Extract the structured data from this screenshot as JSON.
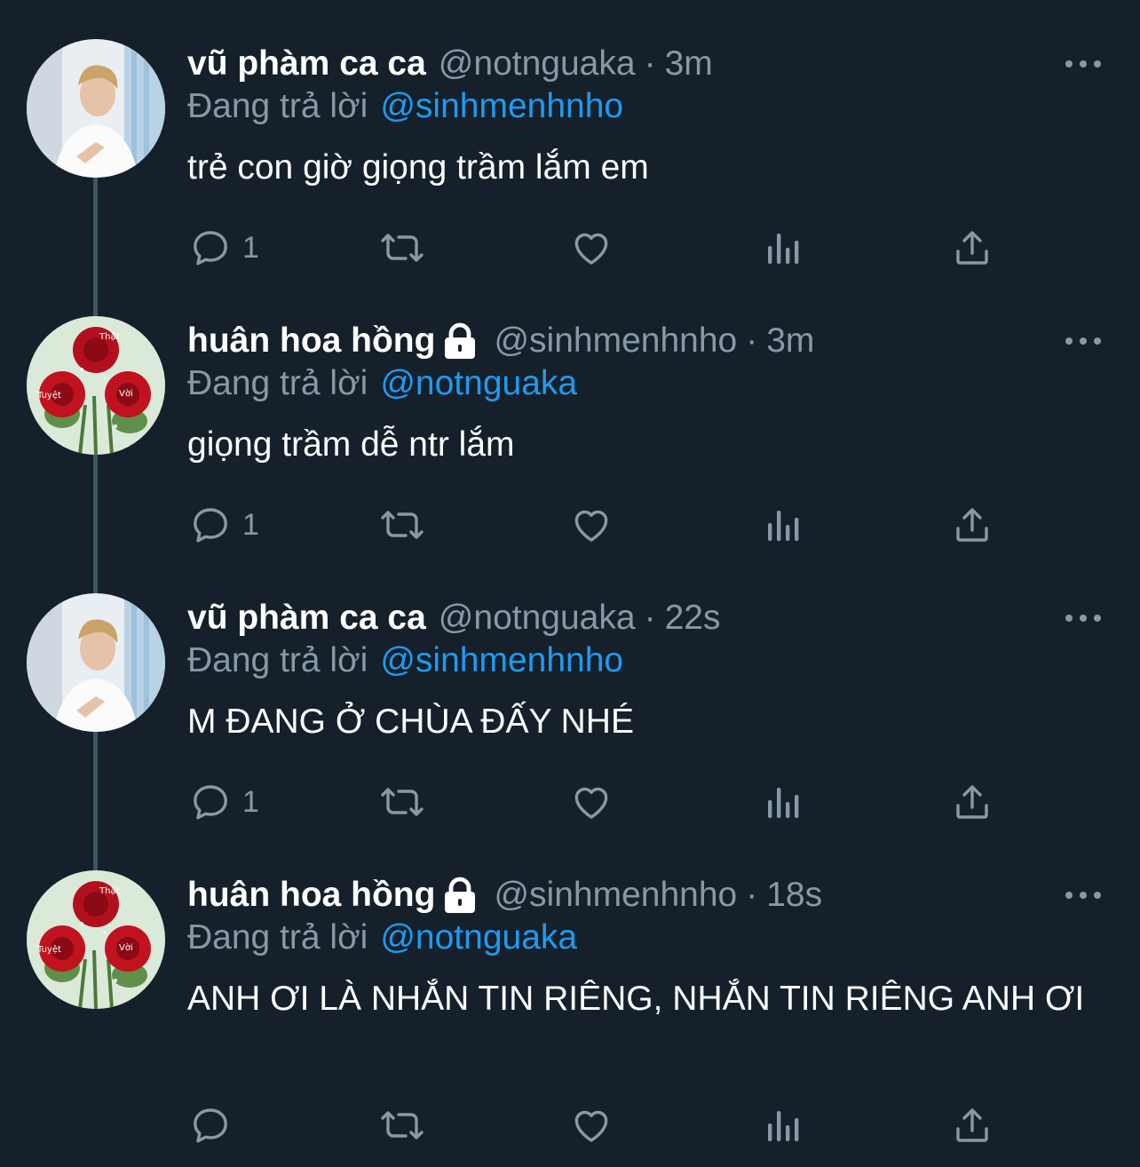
{
  "tweets": [
    {
      "display_name": "vũ phàm ca ca",
      "handle": "@notnguaka",
      "separator": "·",
      "time": "3m",
      "locked": false,
      "reply_prefix": "Đang trả lời",
      "reply_to": "@sinhmenhnho",
      "text": "trẻ con giờ giọng trầm lắm em",
      "reply_count": "1",
      "avatar": "man-avatar"
    },
    {
      "display_name": "huân hoa hồng",
      "handle": "@sinhmenhnho",
      "separator": "·",
      "time": "3m",
      "locked": true,
      "reply_prefix": "Đang trả lời",
      "reply_to": "@notnguaka",
      "text": "giọng trầm dễ ntr lắm",
      "reply_count": "1",
      "avatar": "roses-avatar"
    },
    {
      "display_name": "vũ phàm ca ca",
      "handle": "@notnguaka",
      "separator": "·",
      "time": "22s",
      "locked": false,
      "reply_prefix": "Đang trả lời",
      "reply_to": "@sinhmenhnho",
      "text": "M ĐANG Ở CHÙA ĐẤY NHÉ",
      "reply_count": "1",
      "avatar": "man-avatar"
    },
    {
      "display_name": "huân hoa hồng",
      "handle": "@sinhmenhnho",
      "separator": "·",
      "time": "18s",
      "locked": true,
      "reply_prefix": "Đang trả lời",
      "reply_to": "@notnguaka",
      "text": "ANH ƠI LÀ NHẮN TIN RIÊNG, NHẮN TIN RIÊNG ANH ƠI",
      "reply_count": "",
      "avatar": "roses-avatar"
    }
  ],
  "avatar_texts": {
    "that": "Thật",
    "tuyet": "Tuyệt",
    "voi": "Vời"
  },
  "icons": [
    "reply-icon",
    "retweet-icon",
    "like-icon",
    "analytics-icon",
    "share-icon",
    "more-icon",
    "lock-icon"
  ],
  "colors": {
    "background": "#15202b",
    "secondary_text": "#8899a6",
    "link": "#1d9bf0",
    "thread_line": "#3d5466"
  }
}
